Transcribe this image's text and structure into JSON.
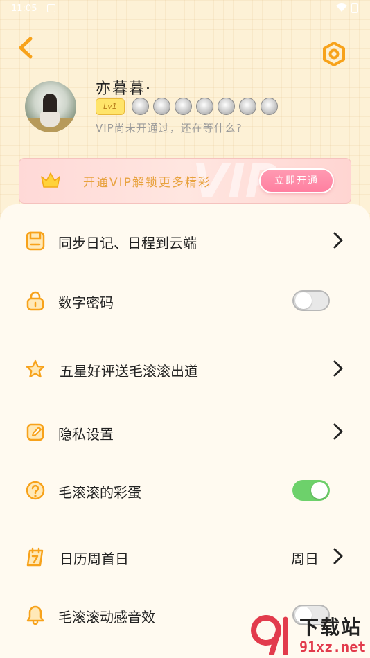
{
  "status_bar": {
    "time": "11:05"
  },
  "profile": {
    "username": "亦暮暮·",
    "level": "Lv1",
    "medal_count": 7,
    "vip_status": "VIP尚未开通过，还在等什么?"
  },
  "vip_banner": {
    "watermark": "VIP",
    "text": "开通VIP解锁更多精彩",
    "button_label": "立即开通"
  },
  "settings": {
    "sync": {
      "label": "同步日记、日程到云端",
      "icon": "save-icon"
    },
    "password": {
      "label": "数字密码",
      "icon": "lock-icon",
      "enabled": false
    },
    "rating": {
      "label": "五星好评送毛滚滚出道",
      "icon": "star-icon"
    },
    "privacy": {
      "label": "隐私设置",
      "icon": "edit-icon"
    },
    "easter_egg": {
      "label": "毛滚滚的彩蛋",
      "icon": "question-icon",
      "enabled": true
    },
    "week_start": {
      "label": "日历周首日",
      "icon": "calendar-icon",
      "value": "周日"
    },
    "sound": {
      "label": "毛滚滚动感音效",
      "icon": "bell-icon",
      "enabled": false
    }
  },
  "watermark": {
    "line1": "下载站",
    "line2": "91xz.net"
  },
  "colors": {
    "accent": "#f7a21b",
    "vip_pink": "#ff7fa0",
    "toggle_on": "#6dd16b",
    "background": "#fdf1d6"
  }
}
